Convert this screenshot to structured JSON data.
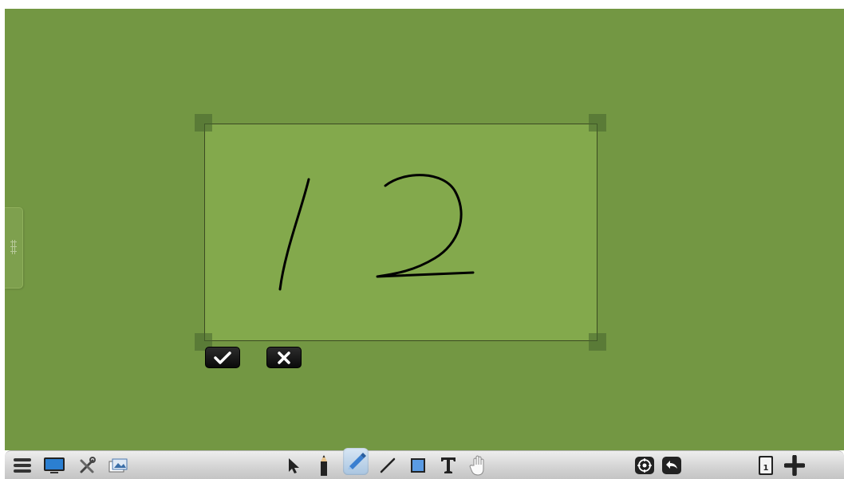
{
  "app": {
    "board_color": "#739743",
    "selection_color": "#83a94c"
  },
  "selection": {
    "handwriting": "12"
  },
  "selection_actions": {
    "confirm_icon": "checkmark-icon",
    "cancel_icon": "x-icon"
  },
  "side_panel": {
    "icon": "grip-icon"
  },
  "toolbar": {
    "left_tools": [
      "menu-icon",
      "monitor-icon",
      "tools-icon",
      "gallery-icon"
    ],
    "drawing_tools": [
      "select-arrow-icon",
      "pencil-icon",
      "highlighter-icon",
      "line-icon",
      "rectangle-icon",
      "text-icon",
      "pan-hand-icon"
    ],
    "active_tool": "highlighter-icon",
    "right_tools": [
      "zoom-target-icon",
      "undo-icon"
    ],
    "page_indicator": "1",
    "add_page_icon": "plus-icon"
  }
}
